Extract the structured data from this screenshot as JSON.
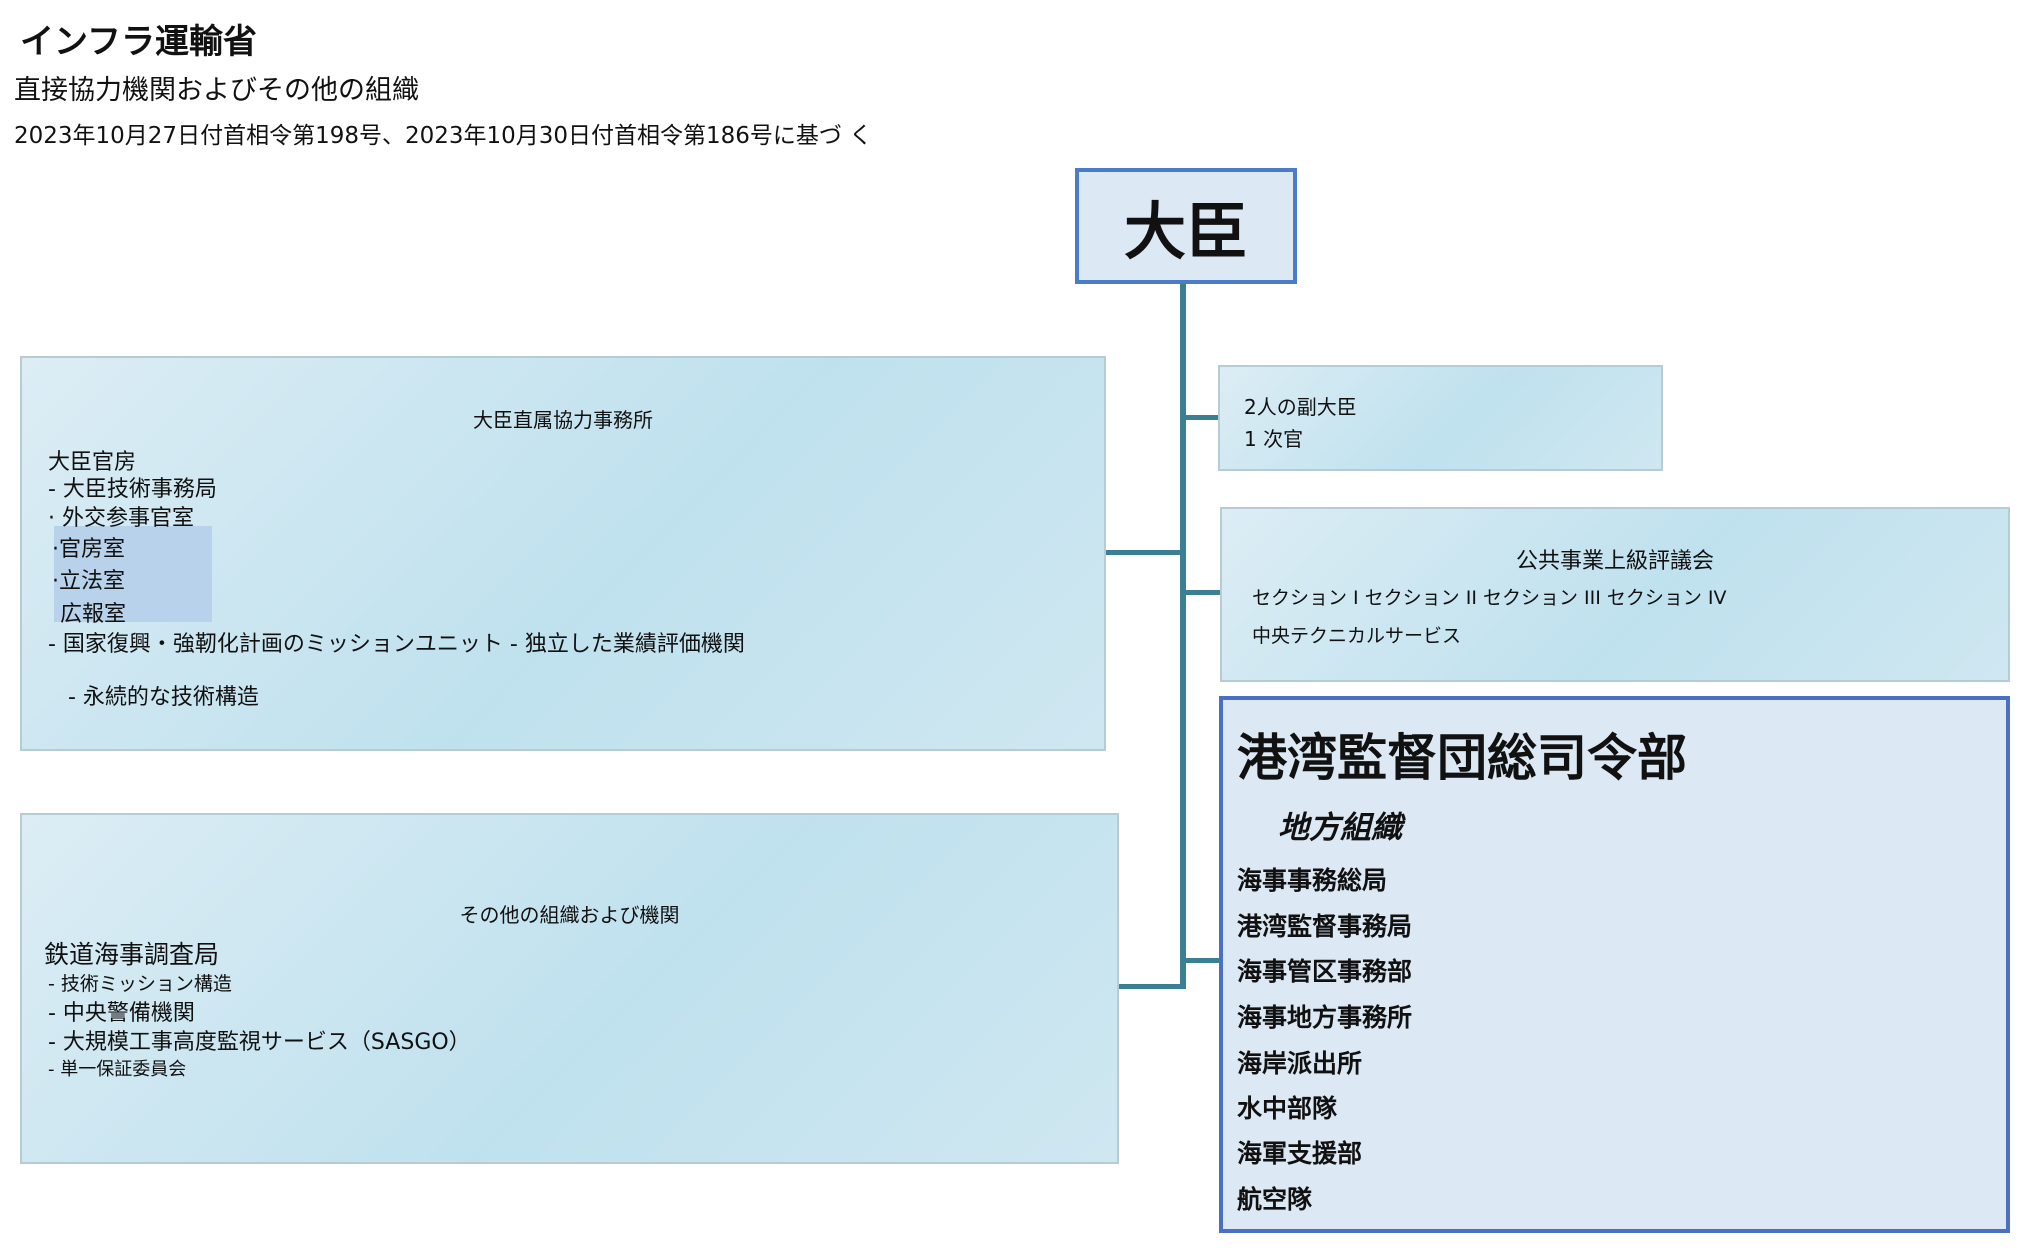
{
  "header": {
    "title": "インフラ運輸省",
    "subtitle": "直接協力機関およびその他の組織",
    "note": "2023年10月27日付首相令第198号、2023年10月30日付首相令第186号に基づ く"
  },
  "minister": {
    "label": "大臣"
  },
  "direct_office": {
    "title": "大臣直属協力事務所",
    "items": [
      "大臣官房",
      "- 大臣技術事務局",
      "· 外交参事官室",
      "·官房室",
      "·立法室",
      "広報室",
      "- 国家復興・強靭化計画のミッションユニット - 独立した業績評価機関",
      "- 永続的な技術構造"
    ]
  },
  "other_orgs": {
    "title": "その他の組織および機関",
    "items": [
      "鉄道海事調査局",
      "- 技術ミッション構造",
      "- 中央警備機関",
      "- 大規模工事高度監視サービス（SASGO）",
      "- 単一保証委員会"
    ]
  },
  "deputies": {
    "items": [
      "2人の副大臣",
      "1 次官"
    ]
  },
  "council": {
    "title": "公共事業上級評議会",
    "sections": "セクション I セクション II セクション III セクション IV",
    "service": "中央テクニカルサービス"
  },
  "port_command": {
    "title": "港湾監督団総司令部",
    "subtitle": "地方組織",
    "items": [
      "海事事務総局",
      "港湾監督事務局",
      "海事管区事務部",
      "海事地方事務所",
      "海岸派出所",
      "水中部隊",
      "海軍支援部",
      "航空隊"
    ]
  }
}
